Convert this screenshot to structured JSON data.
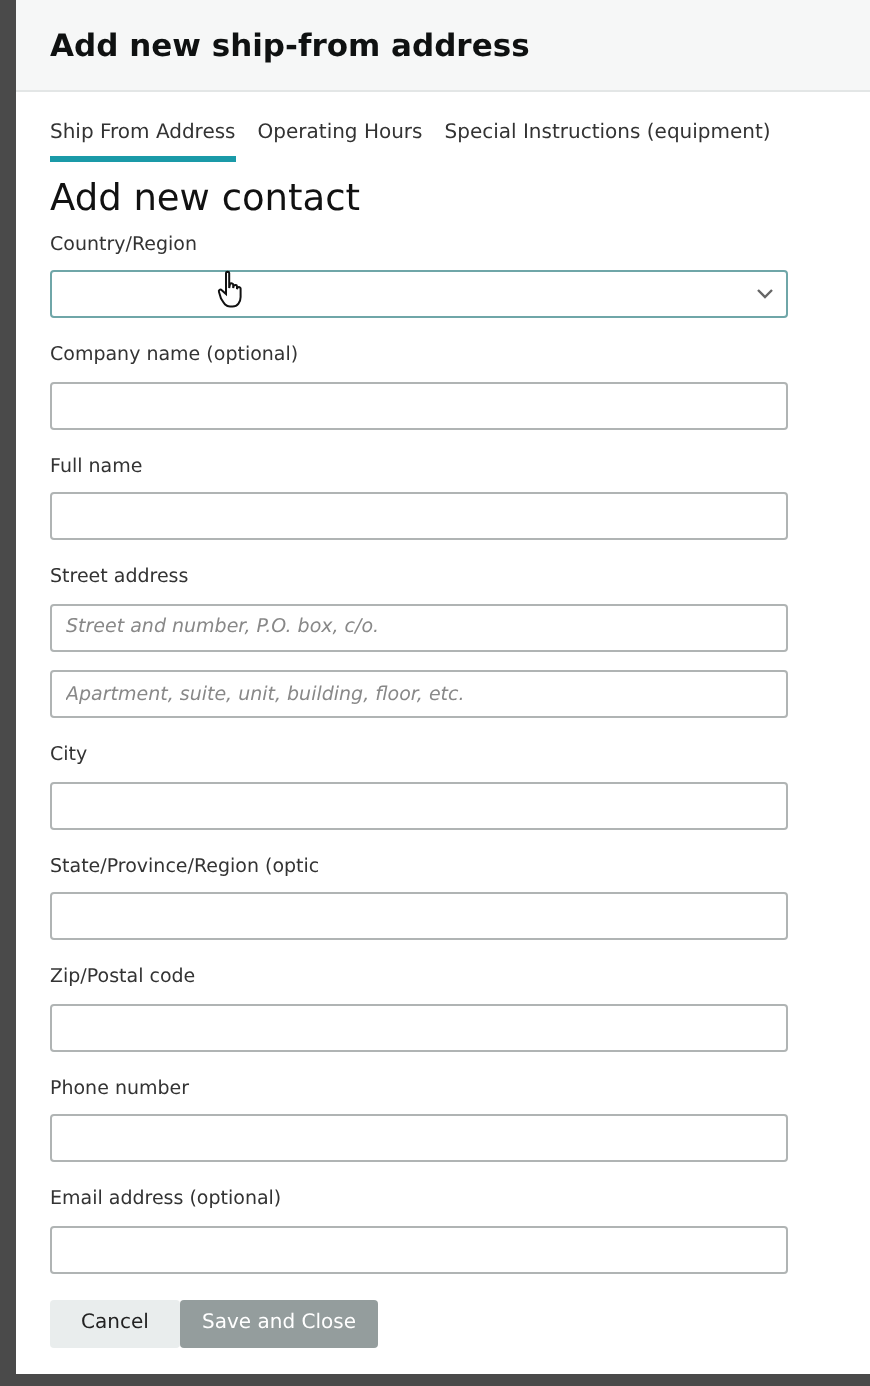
{
  "window": {
    "title": "Add new ship-from address"
  },
  "tabs": [
    {
      "label": "Ship From Address",
      "selected": true
    },
    {
      "label": "Operating Hours",
      "selected": false
    },
    {
      "label": "Special Instructions (equipment)",
      "selected": false
    }
  ],
  "heading": "Add new contact",
  "fields": [
    {
      "kind": "select",
      "label": "Country/Region"
    },
    {
      "kind": "text",
      "label": "Company name (optional)"
    },
    {
      "kind": "text",
      "label": "Full name"
    },
    {
      "kind": "text",
      "label": "Street address",
      "placeholder": "Street and number, P.O. box, c/o."
    },
    {
      "kind": "text",
      "placeholder": "Apartment, suite, unit, building, floor, etc."
    },
    {
      "kind": "text",
      "label": "City"
    },
    {
      "kind": "text",
      "label": "State/Province/Region (optic"
    },
    {
      "kind": "text",
      "label": "Zip/Postal code"
    },
    {
      "kind": "text",
      "label": "Phone number"
    },
    {
      "kind": "text",
      "label": "Email address (optional)"
    }
  ],
  "buttons": [
    {
      "label": "Cancel",
      "kind": "secondary"
    },
    {
      "label": "Save and Close",
      "kind": "primary",
      "disabled": true
    }
  ]
}
